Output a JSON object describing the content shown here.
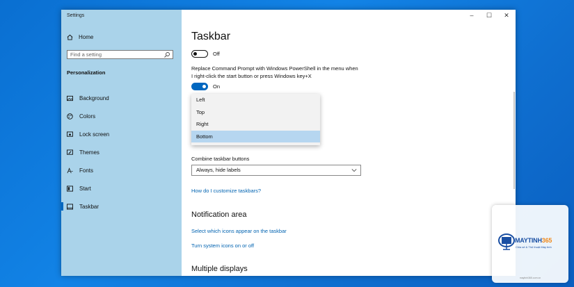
{
  "window": {
    "title": "Settings",
    "controls": {
      "minimize": "–",
      "maximize": "☐",
      "close": "✕"
    }
  },
  "sidebar": {
    "home_label": "Home",
    "search_placeholder": "Find a setting",
    "section_label": "Personalization",
    "items": [
      {
        "label": "Background",
        "icon": "image-icon"
      },
      {
        "label": "Colors",
        "icon": "palette-icon"
      },
      {
        "label": "Lock screen",
        "icon": "lock-screen-icon"
      },
      {
        "label": "Themes",
        "icon": "brush-icon"
      },
      {
        "label": "Fonts",
        "icon": "font-icon"
      },
      {
        "label": "Start",
        "icon": "start-icon"
      },
      {
        "label": "Taskbar",
        "icon": "taskbar-icon",
        "selected": true
      }
    ]
  },
  "main": {
    "page_title": "Taskbar",
    "toggle1": {
      "state_label": "Off",
      "on": false
    },
    "powershell_desc": "Replace Command Prompt with Windows PowerShell in the menu when I right-click the start button or press Windows key+X",
    "toggle2": {
      "state_label": "On",
      "on": true
    },
    "location_menu": {
      "options": [
        "Left",
        "Top",
        "Right",
        "Bottom"
      ],
      "selected": "Bottom"
    },
    "combine": {
      "label": "Combine taskbar buttons",
      "value": "Always, hide labels"
    },
    "customize_link": "How do I customize taskbars?",
    "notification": {
      "heading": "Notification area",
      "link1": "Select which icons appear on the taskbar",
      "link2": "Turn system icons on or off"
    },
    "multiple_displays_heading": "Multiple displays"
  },
  "watermark": {
    "brand_main": "MAYTINH",
    "brand_num": "365",
    "tagline": "Chia sẻ & Thủ thuật Máy tính",
    "foot": "maytinh365.com.vn"
  },
  "colors": {
    "accent": "#0067c0",
    "sidebar_bg": "#aad3ea",
    "link": "#0063b1",
    "highlight": "#b6d6f0"
  }
}
